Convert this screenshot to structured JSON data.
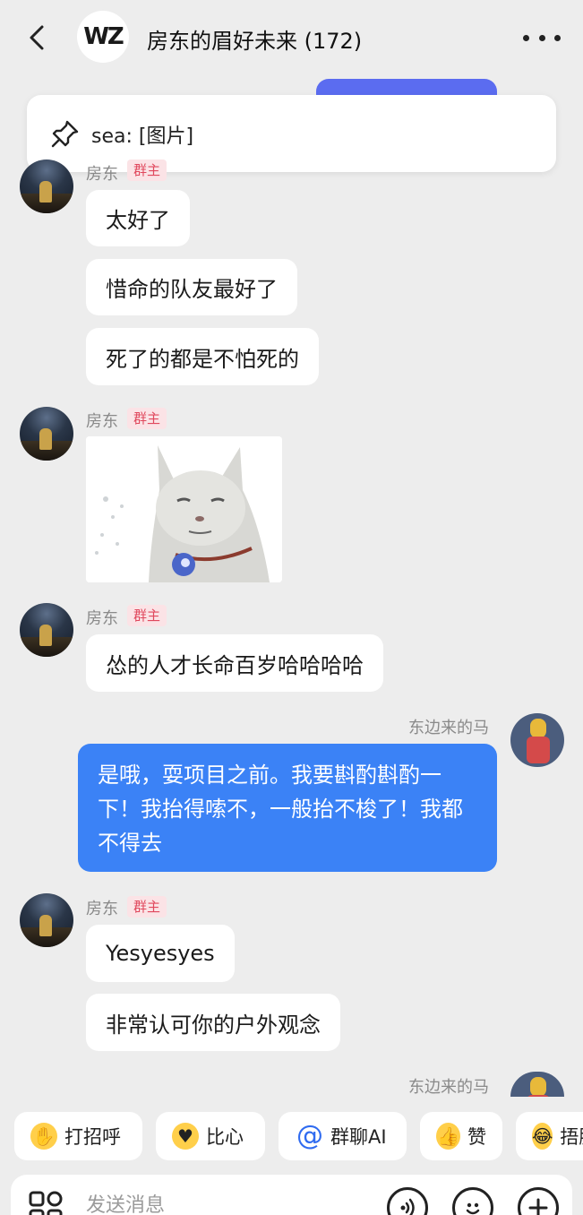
{
  "header": {
    "group_avatar_text": "WZ",
    "title": "房东的眉好未来 (172)"
  },
  "pinned": {
    "text": "sea: [图片]"
  },
  "messages": [
    {
      "sender": "房东",
      "badge": "群主",
      "texts": [
        "太好了",
        "惜命的队友最好了",
        "死了的都是不怕死的"
      ]
    },
    {
      "sender": "房东",
      "badge": "群主",
      "image": "cat-sticker"
    },
    {
      "sender": "房东",
      "badge": "群主",
      "texts": [
        "怂的人才长命百岁哈哈哈哈"
      ]
    },
    {
      "sender": "东边来的马",
      "texts": [
        "是哦，耍项目之前。我要斟酌斟酌一下！我抬得嗦不，一般抬不梭了！我都不得去"
      ]
    },
    {
      "sender": "房东",
      "badge": "群主",
      "texts": [
        "Yesyesyes",
        "非常认可你的户外观念"
      ]
    },
    {
      "sender": "东边来的马"
    }
  ],
  "quick_replies": [
    {
      "label": "打招呼",
      "icon": "wave-emoji-icon"
    },
    {
      "label": "比心",
      "icon": "heart-hands-emoji-icon"
    },
    {
      "label": "群聊AI",
      "icon": "at-icon"
    },
    {
      "label": "赞",
      "icon": "thumbs-up-icon"
    },
    {
      "label": "捂脸",
      "icon": "facepalm-emoji-icon"
    }
  ],
  "input": {
    "placeholder": "发送消息"
  },
  "colors": {
    "background": "#ededed",
    "my_bubble": "#3b82f6",
    "badge_bg": "#fbe3e6",
    "badge_text": "#e0485d",
    "pinned_peek": "#5b6cf0"
  }
}
